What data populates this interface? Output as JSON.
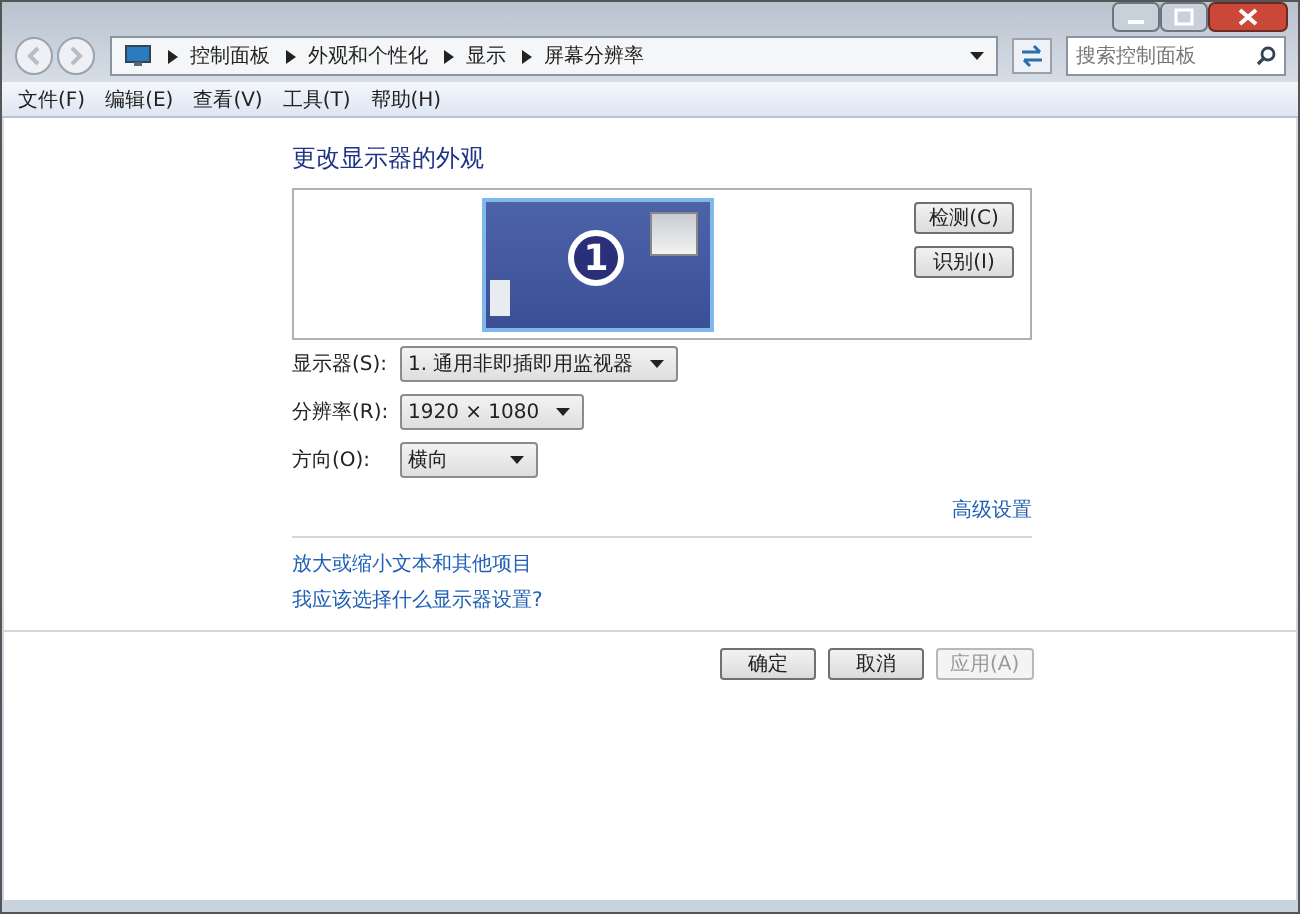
{
  "breadcrumb": [
    "控制面板",
    "外观和个性化",
    "显示",
    "屏幕分辨率"
  ],
  "search": {
    "placeholder": "搜索控制面板"
  },
  "menu": [
    "文件(F)",
    "编辑(E)",
    "查看(V)",
    "工具(T)",
    "帮助(H)"
  ],
  "heading": "更改显示器的外观",
  "preview": {
    "monitor_number": "1",
    "buttons": [
      "检测(C)",
      "识别(I)"
    ]
  },
  "settings": [
    {
      "label": "显示器(S):",
      "value": "1. 通用非即插即用监视器"
    },
    {
      "label": "分辨率(R):",
      "value": "1920 × 1080"
    },
    {
      "label": "方向(O):",
      "value": "横向"
    }
  ],
  "advanced_link": "高级设置",
  "links": [
    "放大或缩小文本和其他项目",
    "我应该选择什么显示器设置?"
  ],
  "buttons": [
    {
      "label": "确定",
      "disabled": false
    },
    {
      "label": "取消",
      "disabled": false
    },
    {
      "label": "应用(A)",
      "disabled": true
    }
  ]
}
